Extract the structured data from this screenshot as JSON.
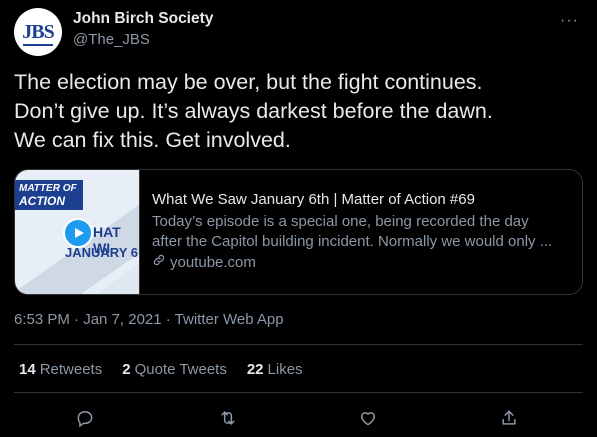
{
  "account": {
    "name": "John Birch Society",
    "handle": "@The_JBS",
    "avatar_text": "JBS",
    "more_label": "···"
  },
  "tweet": {
    "text": "The election may be over, but the fight continues.\nDon’t give up. It’s always darkest before the dawn.\nWe can fix this. Get involved."
  },
  "card": {
    "thumb_banner_line1": "MATTER OF",
    "thumb_banner_line2": "ACTION",
    "thumb_text1": "HAT WI",
    "thumb_text2": "JANUARY 6",
    "title": "What We Saw January 6th | Matter of Action #69",
    "description_line1": "Today’s episode is a special one, being recorded the day",
    "description_line2": "after the Capitol building incident. Normally we would only ...",
    "link": "youtube.com"
  },
  "meta": {
    "timestamp": "6:53 PM · Jan 7, 2021 · Twitter Web App"
  },
  "stats": {
    "retweets_count": "14",
    "retweets_label": "Retweets",
    "quotes_count": "2",
    "quotes_label": "Quote Tweets",
    "likes_count": "22",
    "likes_label": "Likes"
  },
  "colors": {
    "background": "#000000",
    "accent": "#1d9bf0",
    "brand": "#1d3f8f"
  },
  "icons": [
    "reply-icon",
    "retweet-icon",
    "like-icon",
    "share-icon",
    "link-icon",
    "play-icon",
    "more-icon"
  ]
}
